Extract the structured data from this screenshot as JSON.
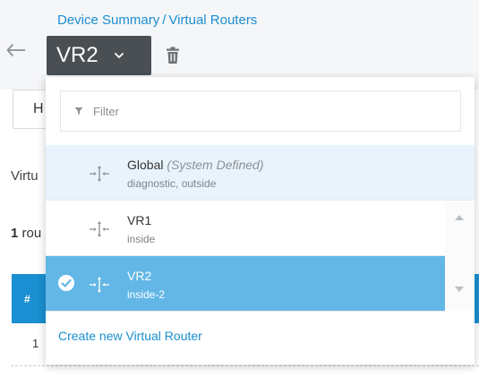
{
  "breadcrumb": {
    "parent": "Device Summary",
    "separator": "/",
    "current": "Virtual Routers"
  },
  "selector": {
    "value": "VR2"
  },
  "background": {
    "tab_label": "H",
    "section_label": "Virtu",
    "count_number": "1",
    "count_text": "rou",
    "table_hash": "#",
    "row_number": "1"
  },
  "dropdown": {
    "filter_placeholder": "Filter",
    "items": [
      {
        "name": "Global",
        "tag": "(System Defined)",
        "interfaces": "diagnostic, outside",
        "icon": "route-icon"
      },
      {
        "name": "VR1",
        "tag": "",
        "interfaces": "inside",
        "icon": "route-icon"
      },
      {
        "name": "VR2",
        "tag": "",
        "interfaces": "inside-2",
        "icon": "route-icon",
        "selected": true
      }
    ],
    "create_link": "Create new Virtual Router"
  },
  "colors": {
    "accent": "#1a8fd1",
    "selected_row": "#63b7e6",
    "system_row": "#e8f3fb",
    "selector_bg": "#4a4f54"
  }
}
